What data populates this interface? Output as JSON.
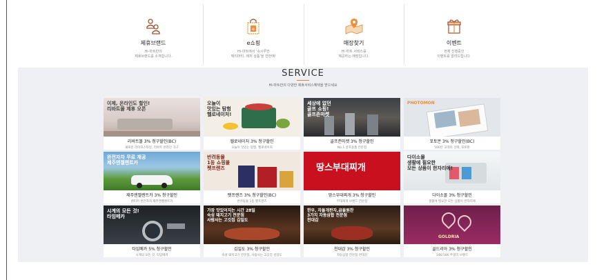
{
  "nav": [
    {
      "icon": "people-icon",
      "title": "제휴브랜드",
      "desc1": "Hi-마트만의",
      "desc2": "제휴브랜드를 소개합니다."
    },
    {
      "icon": "shopping-bag-icon",
      "title": "e쇼핑",
      "desc1": "Hi-마트에서 '속시루한",
      "desc2": "택티머티, 레저 상품'을 한번에!"
    },
    {
      "icon": "map-pin-icon",
      "title": "매장찾기",
      "desc1": "Hi-마트 서비스를",
      "desc2": "제공하는 매장입니다."
    },
    {
      "icon": "gift-icon",
      "title": "이벤트",
      "desc1": "현재 진행중인",
      "desc2": "이벤트를 알려드립니다."
    }
  ],
  "service": {
    "title": "SERVICE",
    "subtitle": "Hi-마트만의 다양한 제휴서비스혜택을 받으세요"
  },
  "cards": [
    {
      "banner": "이제, 온라인도 할인!\n리바트몰 제휴 오픈",
      "title": "리바트몰 3% 청구할인(BC)",
      "desc": "새로운 라이프스타일, 리바트 온라인 가구"
    },
    {
      "banner": "오늘이\n맛있는 탐험\n헬로네이처!",
      "title": "헬로네이처 3% 청구할인",
      "desc": "오늘이 맛있는 탐험, 헬로네이처"
    },
    {
      "banner": "세상에 없던\n골프 쇼핑!\n골프존마켓",
      "title": "골프존마켓 3% 청구할인",
      "desc": "No.1 골프용품 전문점"
    },
    {
      "banner": "PHOTOMON",
      "title": "포토몬 3% 청구할인(BC)",
      "desc": "500만 고객의 선택, 포토몬"
    },
    {
      "banner": "완전자차 무료 제공\n제주엔젤렌트카",
      "title": "제주엔젤렌트카 3% 청구할인",
      "desc": "렌터카 완전자차 제주엔젤렌트카"
    },
    {
      "banner": "반려동물\n1등 쇼핑몰\n펫프렌즈",
      "title": "펫프렌즈 3% 청구할인(BC)",
      "desc": "반려동물 1등 펫프렌즈"
    },
    {
      "banner": "땅스부대찌개",
      "title": "땅스부대찌개 3% 청구할인",
      "desc": "부대찌개 브랜드 전문점"
    },
    {
      "banner": "다이소몰\n생활에 필요한\n모든 상품이 한자리에!",
      "title": "다이소몰 3% 청구할인",
      "desc": "생활에 필요한 모든 상품이 한자리에"
    },
    {
      "banner": "시계의 모든 것!\n타임메카",
      "title": "타임메카 5% 청구할인",
      "desc": "시계의 모든 것, 타임메카"
    },
    {
      "banner": "가장 맛있어지는 시간 28일\n숙성 돼지고기 전문점\n사람사는 고깃집 김일도",
      "title": "김일도 3% 청구할인",
      "desc": "숙성 돼지고기 전문점, 사람사는 고깃집 김일도"
    },
    {
      "banner": "한우, 차돌개판자,곱물원찬\n3가지 자동삼합 전문점\n천대감",
      "title": "천대감 3% 청구할인",
      "desc": "자동삼합 전문점 천대감"
    },
    {
      "banner": "GOLDRIA",
      "title": "골드리아 3% 청구할인",
      "desc": "14K/18K 주얼리 브랜드"
    }
  ]
}
